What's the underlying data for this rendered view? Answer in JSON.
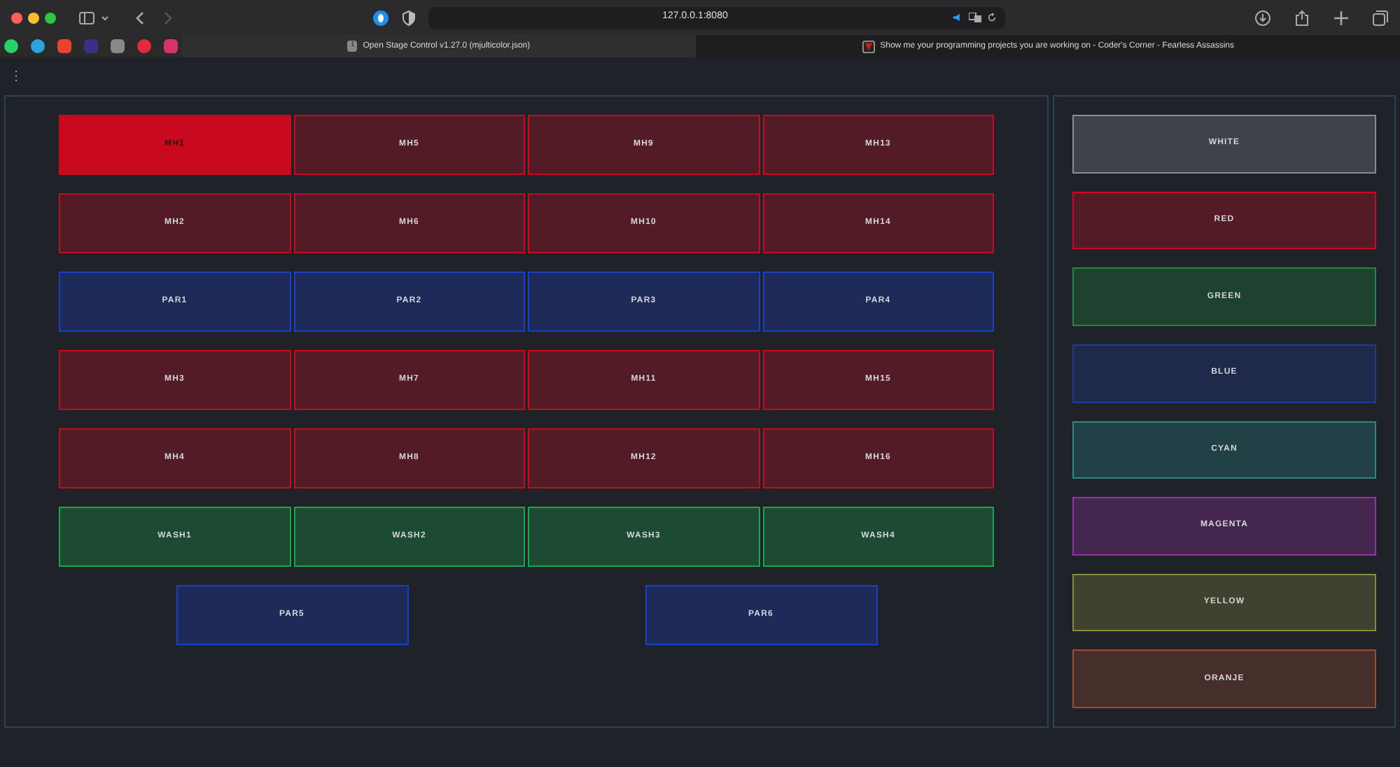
{
  "browser": {
    "url": "127.0.0.1:8080",
    "tabs": [
      {
        "badge": "1",
        "title": "Open Stage Control v1.27.0 (mjulticolor.json)",
        "selected": true
      },
      {
        "title": "Show me your programming projects you are working on - Coder's Corner - Fearless Assassins",
        "selected": false
      }
    ]
  },
  "app": {
    "menu_icon": "⋮",
    "fixture_rows": [
      [
        {
          "label": "MH1",
          "color": "#c8091e",
          "selected": true
        },
        {
          "label": "MH5",
          "color": "#c8091e",
          "selected": false
        },
        {
          "label": "MH9",
          "color": "#c8091e",
          "selected": false
        },
        {
          "label": "MH13",
          "color": "#c8091e",
          "selected": false
        }
      ],
      [
        {
          "label": "MH2",
          "color": "#c8091e",
          "selected": false
        },
        {
          "label": "MH6",
          "color": "#c8091e",
          "selected": false
        },
        {
          "label": "MH10",
          "color": "#c8091e",
          "selected": false
        },
        {
          "label": "MH14",
          "color": "#c8091e",
          "selected": false
        }
      ],
      [
        {
          "label": "PAR1",
          "color": "#1a40c8",
          "selected": false
        },
        {
          "label": "PAR2",
          "color": "#1a40c8",
          "selected": false
        },
        {
          "label": "PAR3",
          "color": "#1a40c8",
          "selected": false
        },
        {
          "label": "PAR4",
          "color": "#1a40c8",
          "selected": false
        }
      ],
      [
        {
          "label": "MH3",
          "color": "#c8091e",
          "selected": false
        },
        {
          "label": "MH7",
          "color": "#c8091e",
          "selected": false
        },
        {
          "label": "MH11",
          "color": "#c8091e",
          "selected": false
        },
        {
          "label": "MH15",
          "color": "#c8091e",
          "selected": false
        }
      ],
      [
        {
          "label": "MH4",
          "color": "#c8091e",
          "selected": false
        },
        {
          "label": "MH8",
          "color": "#c8091e",
          "selected": false
        },
        {
          "label": "MH12",
          "color": "#c8091e",
          "selected": false
        },
        {
          "label": "MH16",
          "color": "#c8091e",
          "selected": false
        }
      ],
      [
        {
          "label": "WASH1",
          "color": "#19a848",
          "selected": false
        },
        {
          "label": "WASH2",
          "color": "#19a848",
          "selected": false
        },
        {
          "label": "WASH3",
          "color": "#19a848",
          "selected": false
        },
        {
          "label": "WASH4",
          "color": "#19a848",
          "selected": false
        }
      ],
      [
        {
          "label": "PAR5",
          "color": "#1a40c8",
          "selected": false
        },
        {
          "label": "PAR6",
          "color": "#1a40c8",
          "selected": false
        }
      ]
    ],
    "color_presets": [
      {
        "label": "WHITE",
        "color": "#8a8c92",
        "selected": false
      },
      {
        "label": "RED",
        "color": "#c8091e",
        "selected": false
      },
      {
        "label": "GREEN",
        "color": "#1e8a3e",
        "selected": false
      },
      {
        "label": "BLUE",
        "color": "#1f3a9a",
        "selected": false
      },
      {
        "label": "CYAN",
        "color": "#2a8a88",
        "selected": false
      },
      {
        "label": "MAGENTA",
        "color": "#9a30a8",
        "selected": false
      },
      {
        "label": "YELLOW",
        "color": "#8a8c38",
        "selected": false
      },
      {
        "label": "ORANJE",
        "color": "#a04a30",
        "selected": false
      }
    ]
  }
}
